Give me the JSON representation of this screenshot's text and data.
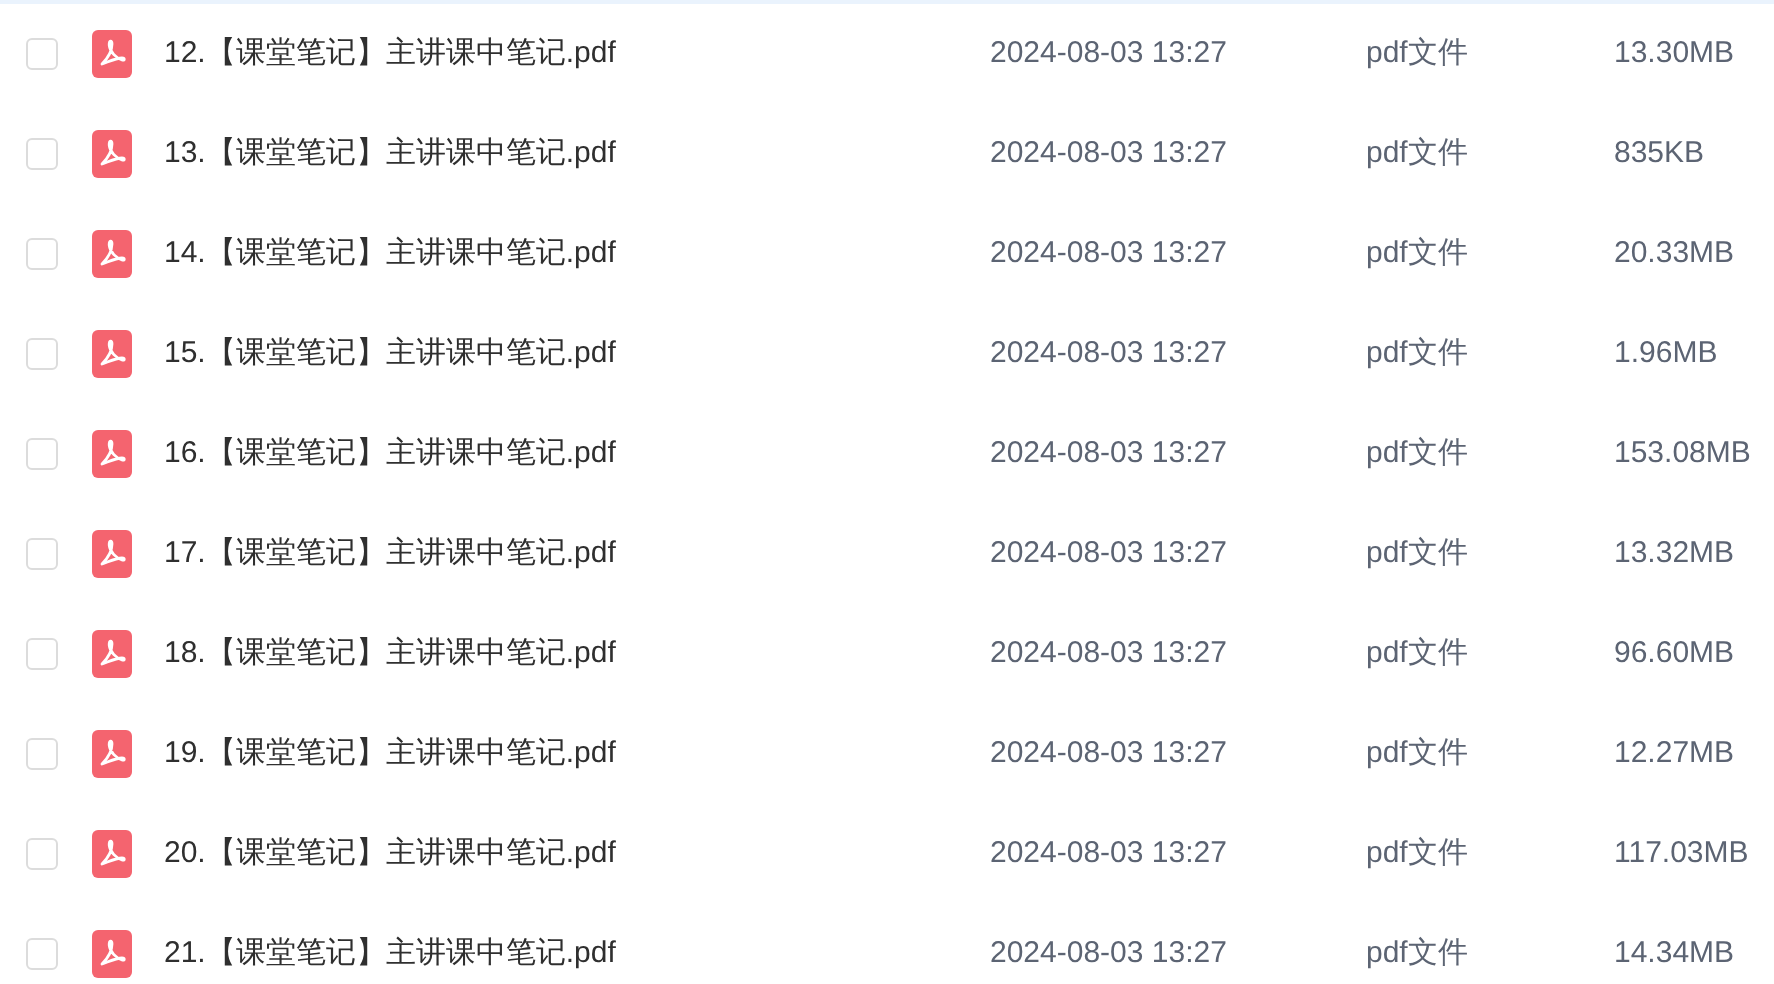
{
  "files": [
    {
      "name": "12.【课堂笔记】主讲课中笔记.pdf",
      "date": "2024-08-03 13:27",
      "type": "pdf文件",
      "size": "13.30MB",
      "checked": false
    },
    {
      "name": "13.【课堂笔记】主讲课中笔记.pdf",
      "date": "2024-08-03 13:27",
      "type": "pdf文件",
      "size": "835KB",
      "checked": false
    },
    {
      "name": "14.【课堂笔记】主讲课中笔记.pdf",
      "date": "2024-08-03 13:27",
      "type": "pdf文件",
      "size": "20.33MB",
      "checked": false
    },
    {
      "name": "15.【课堂笔记】主讲课中笔记.pdf",
      "date": "2024-08-03 13:27",
      "type": "pdf文件",
      "size": "1.96MB",
      "checked": false
    },
    {
      "name": "16.【课堂笔记】主讲课中笔记.pdf",
      "date": "2024-08-03 13:27",
      "type": "pdf文件",
      "size": "153.08MB",
      "checked": false
    },
    {
      "name": "17.【课堂笔记】主讲课中笔记.pdf",
      "date": "2024-08-03 13:27",
      "type": "pdf文件",
      "size": "13.32MB",
      "checked": false
    },
    {
      "name": "18.【课堂笔记】主讲课中笔记.pdf",
      "date": "2024-08-03 13:27",
      "type": "pdf文件",
      "size": "96.60MB",
      "checked": false
    },
    {
      "name": "19.【课堂笔记】主讲课中笔记.pdf",
      "date": "2024-08-03 13:27",
      "type": "pdf文件",
      "size": "12.27MB",
      "checked": false
    },
    {
      "name": "20.【课堂笔记】主讲课中笔记.pdf",
      "date": "2024-08-03 13:27",
      "type": "pdf文件",
      "size": "117.03MB",
      "checked": false
    },
    {
      "name": "21.【课堂笔记】主讲课中笔记.pdf",
      "date": "2024-08-03 13:27",
      "type": "pdf文件",
      "size": "14.34MB",
      "checked": false
    }
  ]
}
